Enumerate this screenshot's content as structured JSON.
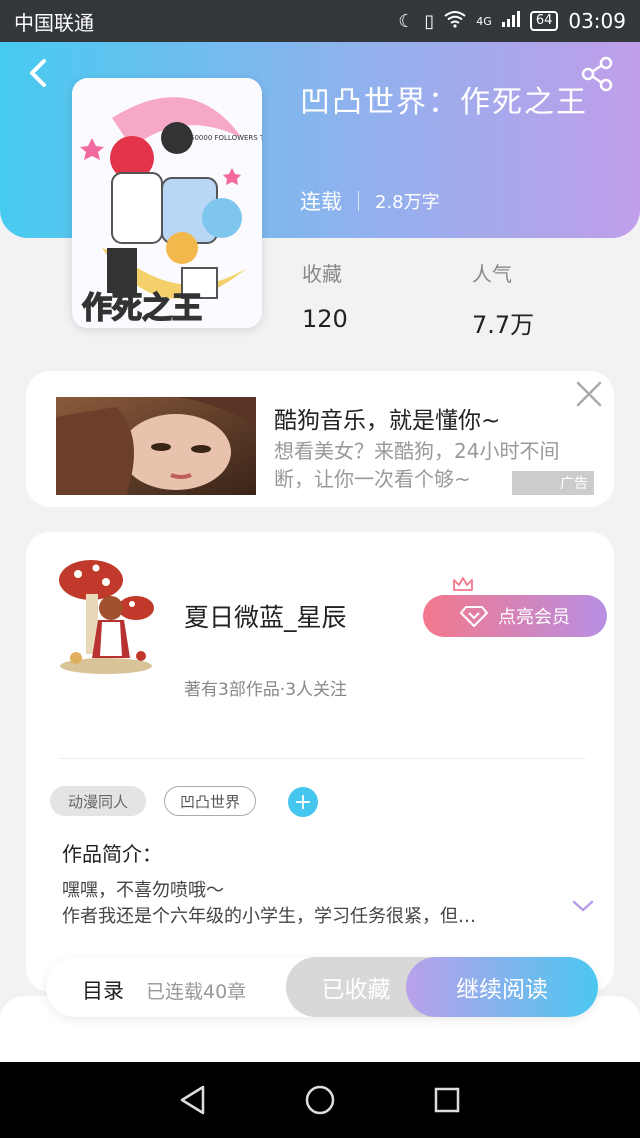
{
  "status_bar": {
    "carrier": "中国联通",
    "network": "4G",
    "battery": "64",
    "time": "03:09"
  },
  "book": {
    "title": "凹凸世界：作死之王",
    "cover_text": "作死之王",
    "cover_banner": "50000 FOLLOWERS THANKS!!",
    "status": "连载",
    "word_count": "2.8万字",
    "favorites_label": "收藏",
    "favorites_value": "120",
    "popularity_label": "人气",
    "popularity_value": "7.7万"
  },
  "ad": {
    "title": "酷狗音乐，就是懂你~",
    "description": "想看美女？来酷狗，24小时不间断，让你一次看个够~",
    "tag": "广告"
  },
  "author": {
    "name": "夏日微蓝_星辰",
    "stats": "著有3部作品·3人关注",
    "vip_button": "点亮会员"
  },
  "tags": [
    "动漫同人",
    "凹凸世界"
  ],
  "intro": {
    "title": "作品简介：",
    "line1": "嘿嘿，不喜勿喷哦～",
    "line2": "作者我还是个六年级的小学生，学习任务很紧，但…"
  },
  "action_bar": {
    "toc_label": "目录",
    "chapter_count": "已连载40章",
    "collected_label": "已收藏",
    "continue_label": "继续阅读"
  },
  "colors": {
    "accent_blue": "#47cbf0",
    "accent_purple": "#c09eea",
    "vip_pink": "#f3788c"
  }
}
